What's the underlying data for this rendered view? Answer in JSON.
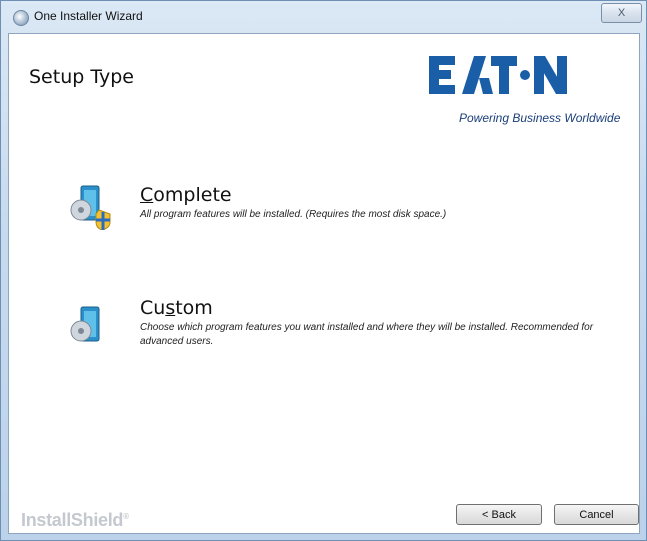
{
  "window": {
    "title": "One Installer Wizard",
    "close_label": "X"
  },
  "page": {
    "title": "Setup Type"
  },
  "brand": {
    "name": "EATON",
    "tagline": "Powering Business Worldwide",
    "color": "#1a5ea8"
  },
  "options": [
    {
      "title_prefix": "",
      "title_mnemonic": "C",
      "title_rest": "omplete",
      "description": "All program features will be installed. (Requires the most disk space.)",
      "icon": "complete-install-icon"
    },
    {
      "title_prefix": "Cu",
      "title_mnemonic": "s",
      "title_rest": "tom",
      "description": "Choose which program features you want installed and where they will be installed. Recommended for advanced users.",
      "icon": "custom-install-icon"
    }
  ],
  "footer": {
    "vendor_logo": "InstallShield",
    "vendor_mark": "®"
  },
  "buttons": {
    "back_label": "< Back",
    "cancel_label": "Cancel"
  }
}
